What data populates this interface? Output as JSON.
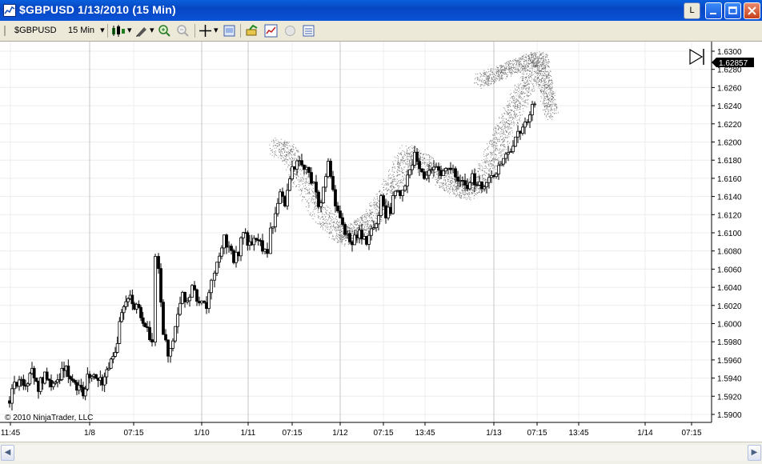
{
  "window": {
    "title": "$GBPUSD  1/13/2010 (15 Min)",
    "l_button": "L"
  },
  "toolbar": {
    "instrument": "$GBPUSD",
    "interval": "15 Min",
    "icons": [
      "candlestick-icon",
      "pencil-icon",
      "zoom-in-icon",
      "zoom-out-icon",
      "crosshair-icon",
      "properties-icon",
      "strategy-icon",
      "indicator-icon",
      "orb-icon",
      "data-box-icon"
    ]
  },
  "chart": {
    "copyright": "© 2010 NinjaTrader, LLC",
    "last_price": "1.62857",
    "y_ticks": [
      "1.6300",
      "1.6280",
      "1.6260",
      "1.6240",
      "1.6220",
      "1.6200",
      "1.6180",
      "1.6160",
      "1.6140",
      "1.6120",
      "1.6100",
      "1.6080",
      "1.6060",
      "1.6040",
      "1.6020",
      "1.6000",
      "1.5980",
      "1.5960",
      "1.5940",
      "1.5920",
      "1.5900"
    ],
    "x_ticks": [
      "11:45",
      "1/8",
      "07:15",
      "1/10",
      "1/11",
      "07:15",
      "1/12",
      "07:15",
      "13:45",
      "1/13",
      "07:15",
      "13:45",
      "1/14",
      "07:15"
    ]
  },
  "chart_data": {
    "type": "line",
    "ylim": [
      1.589,
      1.631
    ],
    "close_path": [
      [
        0,
        1.5915
      ],
      [
        6,
        1.593
      ],
      [
        12,
        1.594
      ],
      [
        20,
        1.5935
      ],
      [
        28,
        1.5945
      ],
      [
        36,
        1.593
      ],
      [
        44,
        1.5945
      ],
      [
        52,
        1.593
      ],
      [
        60,
        1.5935
      ],
      [
        68,
        1.595
      ],
      [
        76,
        1.5945
      ],
      [
        84,
        1.593
      ],
      [
        92,
        1.5925
      ],
      [
        100,
        1.5945
      ],
      [
        108,
        1.594
      ],
      [
        116,
        1.5935
      ],
      [
        124,
        1.595
      ],
      [
        132,
        1.597
      ],
      [
        140,
        1.601
      ],
      [
        148,
        1.603
      ],
      [
        156,
        1.602
      ],
      [
        164,
        1.601
      ],
      [
        172,
        1.599
      ],
      [
        178,
        1.598
      ],
      [
        182,
        1.608
      ],
      [
        186,
        1.606
      ],
      [
        192,
        1.599
      ],
      [
        198,
        1.5965
      ],
      [
        204,
        1.5985
      ],
      [
        210,
        1.601
      ],
      [
        216,
        1.603
      ],
      [
        222,
        1.6025
      ],
      [
        228,
        1.604
      ],
      [
        234,
        1.603
      ],
      [
        240,
        1.6025
      ],
      [
        246,
        1.602
      ],
      [
        252,
        1.605
      ],
      [
        256,
        1.6055
      ],
      [
        262,
        1.607
      ],
      [
        268,
        1.6095
      ],
      [
        274,
        1.608
      ],
      [
        280,
        1.607
      ],
      [
        286,
        1.608
      ],
      [
        292,
        1.61
      ],
      [
        300,
        1.6085
      ],
      [
        308,
        1.6095
      ],
      [
        316,
        1.6085
      ],
      [
        322,
        1.6075
      ],
      [
        326,
        1.61
      ],
      [
        332,
        1.612
      ],
      [
        338,
        1.614
      ],
      [
        344,
        1.6135
      ],
      [
        350,
        1.616
      ],
      [
        356,
        1.6175
      ],
      [
        362,
        1.6185
      ],
      [
        368,
        1.6175
      ],
      [
        374,
        1.6165
      ],
      [
        380,
        1.615
      ],
      [
        386,
        1.613
      ],
      [
        392,
        1.6145
      ],
      [
        398,
        1.6175
      ],
      [
        404,
        1.615
      ],
      [
        410,
        1.612
      ],
      [
        416,
        1.611
      ],
      [
        422,
        1.6095
      ],
      [
        428,
        1.6085
      ],
      [
        434,
        1.61
      ],
      [
        440,
        1.6095
      ],
      [
        446,
        1.609
      ],
      [
        452,
        1.61
      ],
      [
        458,
        1.611
      ],
      [
        464,
        1.6135
      ],
      [
        470,
        1.612
      ],
      [
        476,
        1.6125
      ],
      [
        482,
        1.6145
      ],
      [
        488,
        1.614
      ],
      [
        494,
        1.6155
      ],
      [
        500,
        1.617
      ],
      [
        506,
        1.6185
      ],
      [
        512,
        1.6175
      ],
      [
        518,
        1.6165
      ],
      [
        524,
        1.617
      ],
      [
        530,
        1.6175
      ],
      [
        536,
        1.6165
      ],
      [
        542,
        1.617
      ],
      [
        548,
        1.6175
      ],
      [
        554,
        1.6165
      ],
      [
        560,
        1.616
      ],
      [
        566,
        1.6155
      ],
      [
        572,
        1.615
      ],
      [
        578,
        1.616
      ],
      [
        584,
        1.6155
      ],
      [
        590,
        1.615
      ],
      [
        596,
        1.6155
      ],
      [
        602,
        1.616
      ],
      [
        608,
        1.617
      ],
      [
        614,
        1.618
      ],
      [
        620,
        1.619
      ],
      [
        626,
        1.6195
      ],
      [
        632,
        1.62
      ],
      [
        638,
        1.6215
      ],
      [
        644,
        1.622
      ],
      [
        650,
        1.6235
      ],
      [
        656,
        1.624
      ],
      [
        660,
        1.6245
      ]
    ]
  }
}
